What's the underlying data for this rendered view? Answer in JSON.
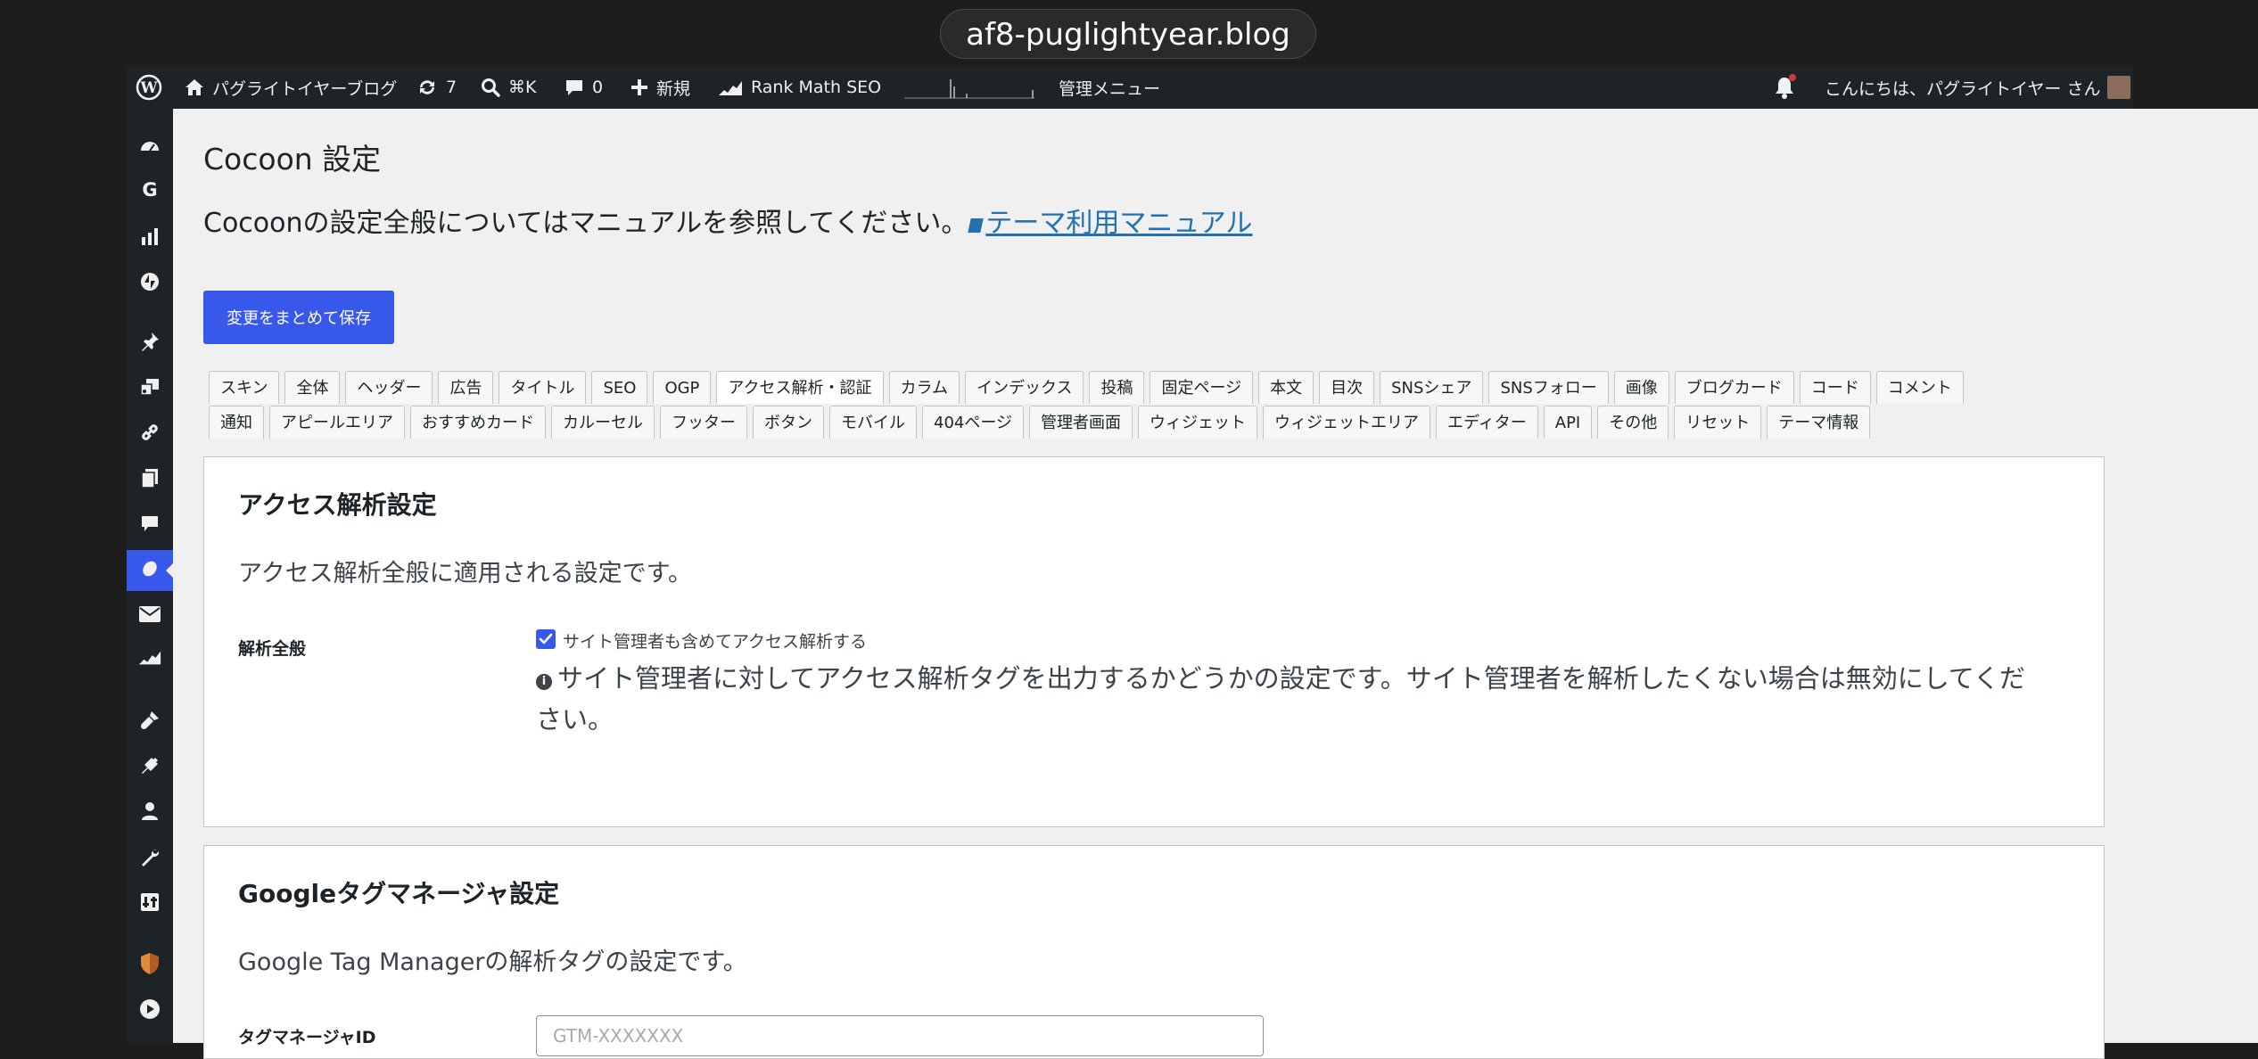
{
  "browser": {
    "url": "af8-puglightyear.blog"
  },
  "adminbar": {
    "site_name": "パグライトイヤーブログ",
    "updates_count": "7",
    "search_shortcut": "⌘K",
    "comments_count": "0",
    "new_label": "新規",
    "rankmath_label": "Rank Math SEO",
    "admin_menu_label": "管理メニュー",
    "greeting": "こんにちは、パグライトイヤー さん"
  },
  "sidebar": {
    "items": [
      "dashboard-icon",
      "google-icon",
      "analytics-icon",
      "jetpack-icon",
      "pin-icon",
      "media-icon",
      "links-icon",
      "pages-icon",
      "comments-icon",
      "cocoon-icon",
      "mail-icon",
      "rankmath-icon",
      "appearance-icon",
      "plugins-icon",
      "users-icon",
      "tools-icon",
      "settings-icon",
      "shield-icon",
      "play-icon"
    ],
    "active_index": 9
  },
  "page": {
    "title": "Cocoon 設定",
    "intro_text": "Cocoonの設定全般についてはマニュアルを参照してください。",
    "manual_link": "テーマ利用マニュアル",
    "save_button": "変更をまとめて保存"
  },
  "tabs": {
    "row1": [
      "スキン",
      "全体",
      "ヘッダー",
      "広告",
      "タイトル",
      "SEO",
      "OGP",
      "アクセス解析・認証",
      "カラム",
      "インデックス",
      "投稿",
      "固定ページ",
      "本文",
      "目次",
      "SNSシェア",
      "SNSフォロー",
      "画像",
      "ブログカード",
      "コード",
      "コメント"
    ],
    "row2": [
      "通知",
      "アピールエリア",
      "おすすめカード",
      "カルーセル",
      "フッター",
      "ボタン",
      "モバイル",
      "404ページ",
      "管理者画面",
      "ウィジェット",
      "ウィジェットエリア",
      "エディター",
      "API",
      "その他",
      "リセット",
      "テーマ情報"
    ],
    "active": "アクセス解析・認証"
  },
  "access_panel": {
    "title": "アクセス解析設定",
    "description": "アクセス解析全般に適用される設定です。",
    "row_label": "解析全般",
    "checkbox_label": "サイト管理者も含めてアクセス解析する",
    "checkbox_checked": true,
    "note_line1": "サイト管理者に対してアクセス解析タグを出力するかどうかの設定です。サイト管理者を解析したくない場合は無効にしてくだ",
    "note_line2": "さい。"
  },
  "gtm_panel": {
    "title": "Googleタグマネージャ設定",
    "description": "Google Tag Managerの解析タグの設定です。",
    "row_label": "タグマネージャID",
    "input_placeholder": "GTM-XXXXXXX",
    "input_value": ""
  },
  "colors": {
    "accent": "#3858e9",
    "adminbar_bg": "#1d2327",
    "content_bg": "#f0f0f1",
    "notification_dot": "#d63638"
  }
}
